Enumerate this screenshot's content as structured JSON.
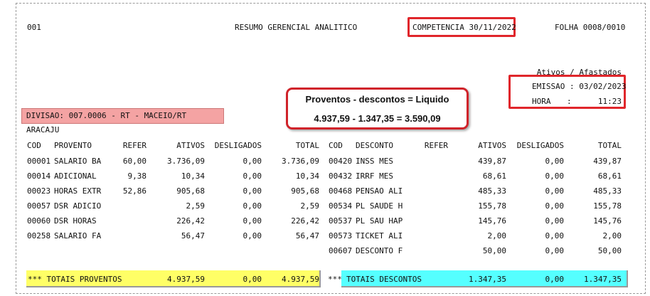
{
  "header": {
    "code": "001",
    "title": "RESUMO GERENCIAL ANALITICO",
    "competencia": "COMPETENCIA 30/11/2022",
    "folha": "FOLHA 0008/0010"
  },
  "status": {
    "label": "Ativos / Afastados",
    "emissao": "EMISSAO : 03/02/2023",
    "hora_label": "HORA",
    "hora_sep": ":",
    "hora_value": "11:23"
  },
  "callout": {
    "line1": "Proventos - descontos = Liquido",
    "line2": "4.937,59 - 1.347,35 = 3.590,09"
  },
  "divisao": "DIVISAO: 007.0006 - RT - MACEIO/RT ARACAJU",
  "left_headers": {
    "cod": "COD",
    "provento": "PROVENTO",
    "refer": "REFER",
    "ativos": "ATIVOS",
    "desligados": "DESLIGADOS",
    "total": "TOTAL"
  },
  "right_headers": {
    "cod": "COD",
    "desconto": "DESCONTO",
    "refer": "REFER",
    "ativos": "ATIVOS",
    "desligados": "DESLIGADOS",
    "total": "TOTAL"
  },
  "proventos": [
    {
      "cod": "00001",
      "desc": "SALARIO BA",
      "refer": "60,00",
      "ativos": "3.736,09",
      "desligados": "0,00",
      "total": "3.736,09"
    },
    {
      "cod": "00014",
      "desc": "ADICIONAL",
      "refer": "9,38",
      "ativos": "10,34",
      "desligados": "0,00",
      "total": "10,34"
    },
    {
      "cod": "00023",
      "desc": "HORAS EXTR",
      "refer": "52,86",
      "ativos": "905,68",
      "desligados": "0,00",
      "total": "905,68"
    },
    {
      "cod": "00057",
      "desc": "DSR ADICIO",
      "refer": "",
      "ativos": "2,59",
      "desligados": "0,00",
      "total": "2,59"
    },
    {
      "cod": "00060",
      "desc": "DSR HORAS",
      "refer": "",
      "ativos": "226,42",
      "desligados": "0,00",
      "total": "226,42"
    },
    {
      "cod": "00258",
      "desc": "SALARIO FA",
      "refer": "",
      "ativos": "56,47",
      "desligados": "0,00",
      "total": "56,47"
    }
  ],
  "descontos": [
    {
      "cod": "00420",
      "desc": "INSS MES",
      "refer": "",
      "ativos": "439,87",
      "desligados": "0,00",
      "total": "439,87"
    },
    {
      "cod": "00432",
      "desc": "IRRF MES",
      "refer": "",
      "ativos": "68,61",
      "desligados": "0,00",
      "total": "68,61"
    },
    {
      "cod": "00468",
      "desc": "PENSAO ALI",
      "refer": "",
      "ativos": "485,33",
      "desligados": "0,00",
      "total": "485,33"
    },
    {
      "cod": "00534",
      "desc": "PL SAUDE H",
      "refer": "",
      "ativos": "155,78",
      "desligados": "0,00",
      "total": "155,78"
    },
    {
      "cod": "00537",
      "desc": "PL SAU HAP",
      "refer": "",
      "ativos": "145,76",
      "desligados": "0,00",
      "total": "145,76"
    },
    {
      "cod": "00573",
      "desc": "TICKET ALI",
      "refer": "",
      "ativos": "2,00",
      "desligados": "0,00",
      "total": "2,00"
    },
    {
      "cod": "00607",
      "desc": "DESCONTO F",
      "refer": "",
      "ativos": "50,00",
      "desligados": "0,00",
      "total": "50,00"
    }
  ],
  "totals_proventos": {
    "label": "*** TOTAIS PROVENTOS",
    "ativos": "4.937,59",
    "desligados": "0,00",
    "total": "4.937,59"
  },
  "totals_descontos": {
    "stars": "***",
    "label": "TOTAIS DESCONTOS",
    "ativos": "1.347,35",
    "desligados": "0,00",
    "total": "1.347,35"
  }
}
